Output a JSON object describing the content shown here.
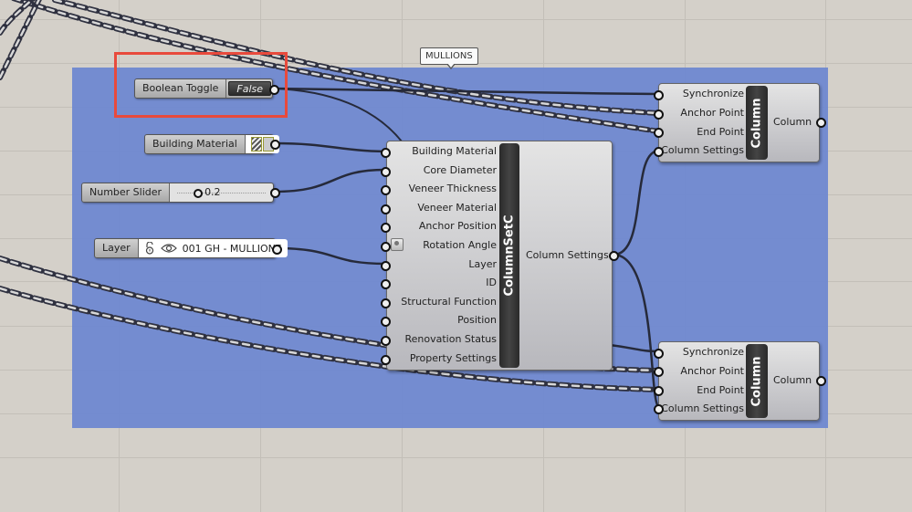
{
  "group": {
    "label": "MULLIONS",
    "color": "#7189cf"
  },
  "highlight_color": "#e84a3c",
  "params": {
    "boolean_toggle": {
      "label": "Boolean Toggle",
      "value": "False"
    },
    "building_material": {
      "label": "Building Material",
      "icon": "material-swatch-icon"
    },
    "number_slider": {
      "label": "Number Slider",
      "value": "0.2"
    },
    "layer": {
      "label": "Layer",
      "value": "001 GH - MULLIONS",
      "icons": [
        "unlock-icon",
        "eye-icon"
      ]
    }
  },
  "column_set": {
    "name": "ColumnSetC",
    "inputs": [
      "Building Material",
      "Core Diameter",
      "Veneer Thickness",
      "Veneer Material",
      "Anchor Position",
      "Rotation Angle",
      "Layer",
      "ID",
      "Structural Function",
      "Position",
      "Renovation Status",
      "Property Settings"
    ],
    "output": "Column Settings"
  },
  "columns": [
    {
      "name": "Column",
      "inputs": [
        "Synchronize",
        "Anchor Point",
        "End Point",
        "Column Settings"
      ],
      "output": "Column"
    },
    {
      "name": "Column",
      "inputs": [
        "Synchronize",
        "Anchor Point",
        "End Point",
        "Column Settings"
      ],
      "output": "Column"
    }
  ]
}
